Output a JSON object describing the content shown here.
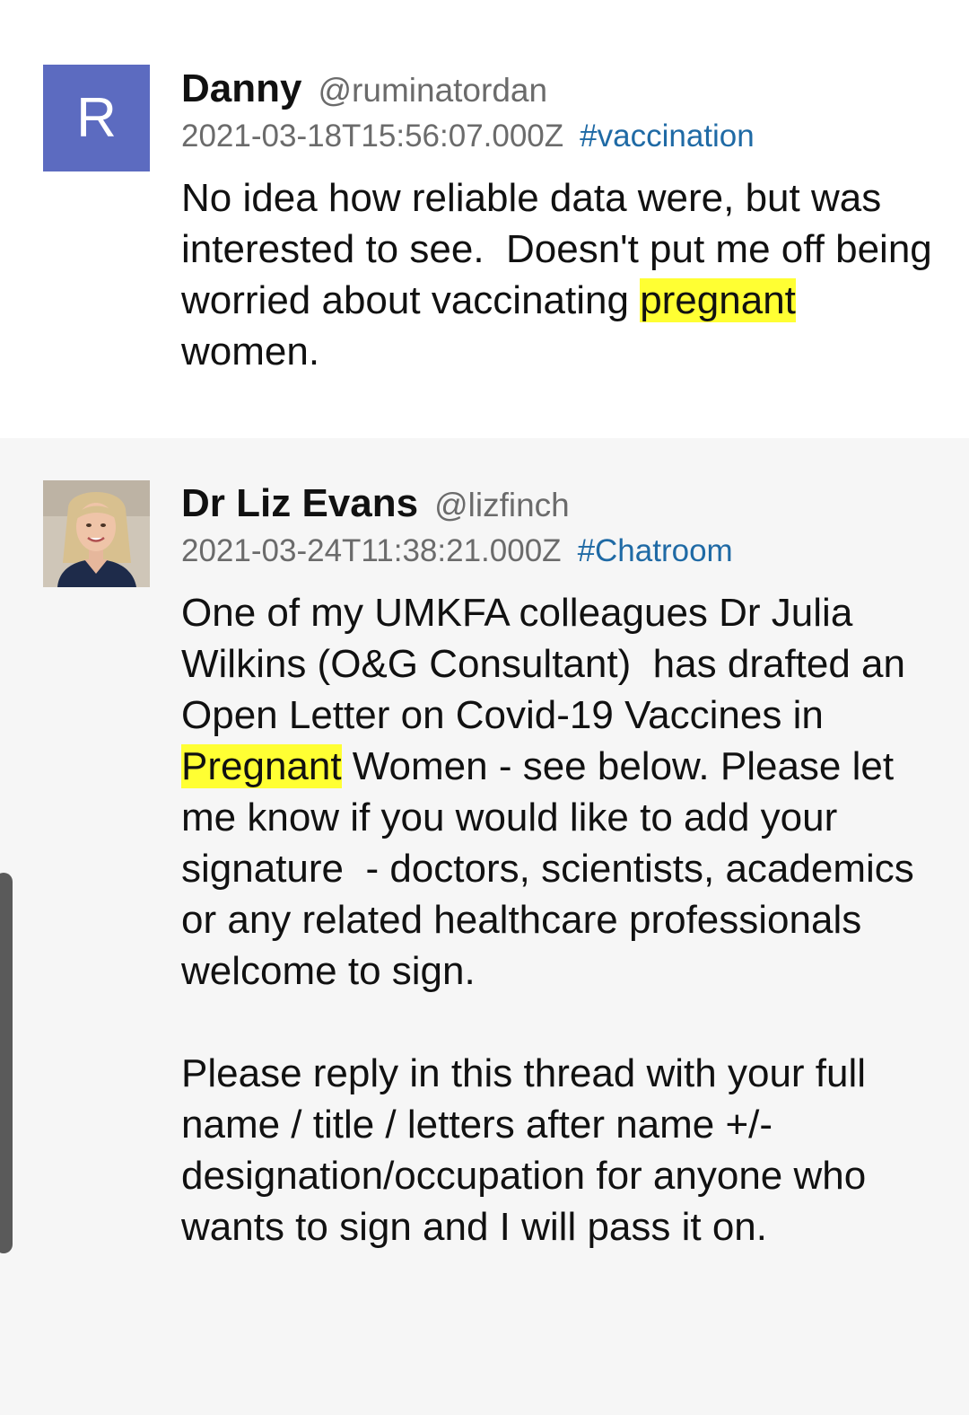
{
  "posts": [
    {
      "avatar_letter": "R",
      "avatar_color": "#5c6bc0",
      "author": "Danny",
      "handle": "@ruminatordan",
      "timestamp": "2021-03-18T15:56:07.000Z",
      "hashtag": "#vaccination",
      "body": {
        "part1": "No idea how reliable data were, but was interested to see.  Doesn't put me off being worried about vaccinating ",
        "highlight": "pregnant",
        "part2": " women."
      }
    },
    {
      "avatar_icon": "profile-photo",
      "author": "Dr Liz Evans",
      "handle": "@lizfinch",
      "timestamp": "2021-03-24T11:38:21.000Z",
      "hashtag": "#Chatroom",
      "body": {
        "part1": "One of my UMKFA colleagues Dr Julia Wilkins (O&G Consultant)  has drafted an Open Letter on Covid-19 Vaccines in ",
        "highlight": "Pregnant",
        "part2": " Women - see below. Please let me know if you would like to add your signature  - doctors, scientists, academics or any related healthcare professionals welcome to sign.",
        "paragraph2": "Please reply in this thread with your full name / title / letters after name +/- designation/occupation for anyone who wants to sign and I will pass it on."
      }
    }
  ],
  "colors": {
    "highlight": "#ffff33",
    "hashtag": "#1f6aa5",
    "meta_text": "#6b6b6b"
  }
}
